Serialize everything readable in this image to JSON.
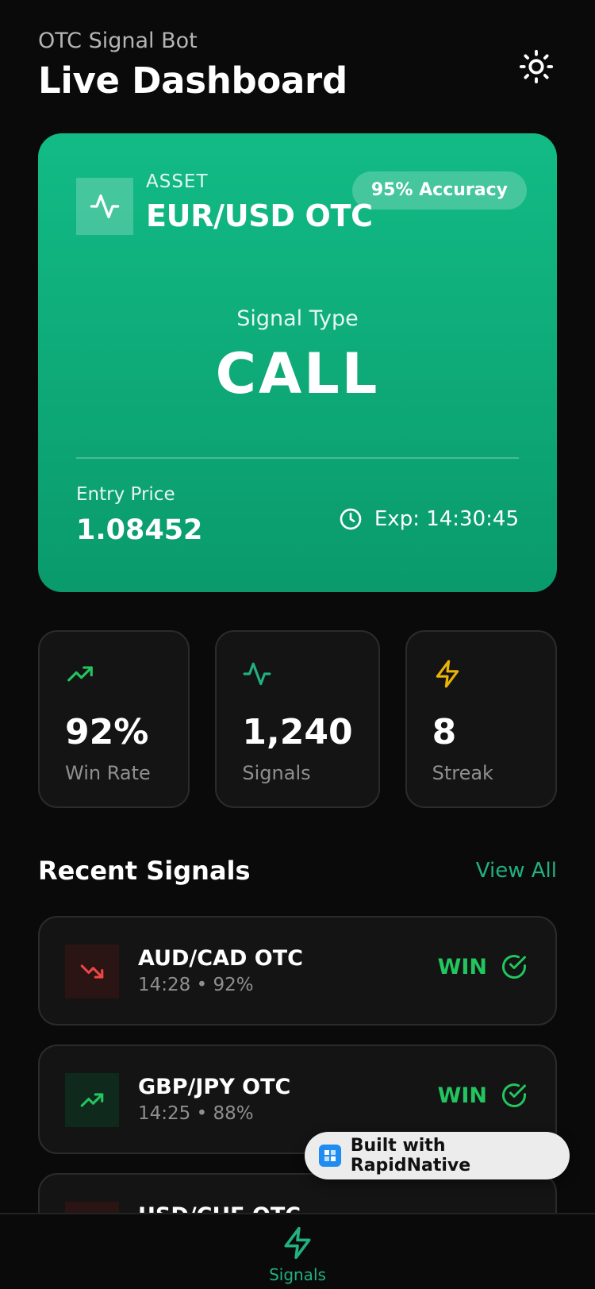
{
  "header": {
    "app_name": "OTC Signal Bot",
    "title": "Live Dashboard"
  },
  "signal_card": {
    "asset_label": "ASSET",
    "asset_name": "EUR/USD OTC",
    "accuracy": "95% Accuracy",
    "signal_type_label": "Signal Type",
    "signal_type": "CALL",
    "entry_label": "Entry Price",
    "entry_price": "1.08452",
    "expiry": "Exp: 14:30:45",
    "gradient_top": "#12bb85",
    "gradient_bottom": "#0a9a6b"
  },
  "stats": [
    {
      "icon": "trending-up-icon",
      "value": "92%",
      "label": "Win Rate",
      "color": "#22c55e"
    },
    {
      "icon": "activity-icon",
      "value": "1,240",
      "label": "Signals",
      "color": "#22b07f"
    },
    {
      "icon": "zap-icon",
      "value": "8",
      "label": "Streak",
      "color": "#eab308"
    }
  ],
  "recent": {
    "title": "Recent Signals",
    "view_all": "View All",
    "items": [
      {
        "pair": "AUD/CAD OTC",
        "meta": "14:28 • 92%",
        "result": "WIN",
        "trend": "down"
      },
      {
        "pair": "GBP/JPY OTC",
        "meta": "14:25 • 88%",
        "result": "WIN",
        "trend": "up"
      },
      {
        "pair": "USD/CHF OTC",
        "meta": "",
        "result": "",
        "trend": "down"
      }
    ]
  },
  "built_badge": {
    "label": "Built with RapidNative"
  },
  "nav": {
    "signals_label": "Signals"
  },
  "colors": {
    "accent": "#22b07f",
    "win": "#22c55e",
    "loss": "#ef4444",
    "background": "#0a0a0a",
    "card": "#141414"
  }
}
